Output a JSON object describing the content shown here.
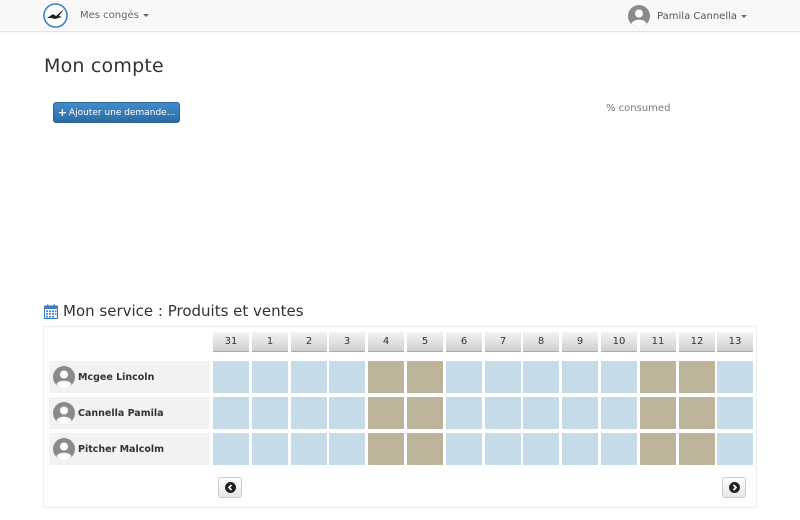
{
  "navbar": {
    "menu_label": "Mes congés",
    "user_name": "Pamila Cannella"
  },
  "page": {
    "title": "Mon compte",
    "add_request_label": "Ajouter une demande...",
    "consumed_label": "% consumed"
  },
  "team": {
    "title": "Mon service : Produits et ventes",
    "days": [
      "31",
      "1",
      "2",
      "3",
      "4",
      "5",
      "6",
      "7",
      "8",
      "9",
      "10",
      "11",
      "12",
      "13"
    ],
    "day_status": [
      "work",
      "work",
      "work",
      "work",
      "off",
      "off",
      "work",
      "work",
      "work",
      "work",
      "work",
      "off",
      "off",
      "work"
    ],
    "members": [
      {
        "name": "Mcgee Lincoln"
      },
      {
        "name": "Cannella Pamila"
      },
      {
        "name": "Pitcher Malcolm"
      }
    ]
  },
  "colors": {
    "working_day": "#c5dbe7",
    "non_working_day": "#bcb39a",
    "primary_button": "#428bca"
  }
}
